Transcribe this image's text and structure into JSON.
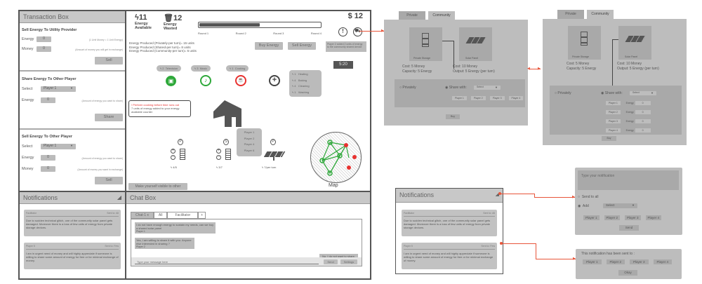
{
  "transaction": {
    "title": "Transaction Box",
    "utility": {
      "title": "Sell Energy To Utility Provider",
      "energy_label": "Energy",
      "energy_value": "0",
      "energy_hint": "(1 Unit Money = 1 Unit Energy)",
      "money_label": "Money",
      "money_value": "0",
      "money_hint": "(Amount of money you will get in exchange)",
      "button": "Sell"
    },
    "share": {
      "title": "Share Energy To Other Player",
      "select_label": "Select",
      "select_value": "Player 1",
      "energy_label": "Energy",
      "energy_value": "0",
      "energy_hint": "(Amount of energy you want to share)",
      "button": "Share"
    },
    "sell_player": {
      "title": "Sell Energy To Other Player",
      "select_label": "Select",
      "select_value": "Player 1",
      "energy_label": "Energy",
      "energy_value": "0",
      "energy_hint": "(Amount of energy you want to share)",
      "money_label": "Money",
      "money_value": "0",
      "money_hint": "(Amount of money you want in exchange)",
      "button": "Sell"
    }
  },
  "game": {
    "energy_available": "11",
    "energy_available_label": "Energy Available",
    "energy_wasted": "12",
    "energy_wasted_label": "Energy Wasted",
    "money": "$ 12",
    "progress": 0.5,
    "rounds": [
      "Round 1",
      "Round 2",
      "Round 3",
      "Round 4"
    ],
    "production": [
      "Energy Produced (Privately-per turn)= 15 units",
      "Energy Produced (Shared-per turn)= 8 units",
      "Energy Produced (Community-per turn)= 6 units"
    ],
    "buy_energy": "Buy Energy",
    "sell_energy": "Sell Energy",
    "tooltip": "Player 2 added 2 units of energy to the community shared device",
    "timer": "5:20",
    "appliances": [
      {
        "cost": "2",
        "name": "Television"
      },
      {
        "cost": "3",
        "name": "Music"
      },
      {
        "cost": "1",
        "name": "Cooking"
      }
    ],
    "add_menu": [
      {
        "cost": "1",
        "name": "Heating"
      },
      {
        "cost": "4",
        "name": "Baking"
      },
      {
        "cost": "4",
        "name": "Cleaning"
      },
      {
        "cost": "1",
        "name": "Washing"
      }
    ],
    "alert_title": "! Perform cooking before time runs out",
    "alert_body": "7 units of energy added to your energy available counter",
    "players_popup": [
      "Player 1",
      "Player 2",
      "Player 4",
      "Player 6"
    ],
    "devices": [
      {
        "badge": "P",
        "value": "4/5"
      },
      {
        "badge": "S",
        "value": "3/7"
      },
      {
        "badge": "P",
        "value": "7/per turn"
      }
    ],
    "map_label": "Map",
    "visible_button": "Make yourself visible to other"
  },
  "notifications": {
    "title": "Notifications",
    "items": [
      {
        "from": "Facilitator",
        "to": "Sent to: All",
        "body": "Due to sudden technical glitch, one of the community solar panel gets damaged. Moreover there is a loss of few units of energy from private storage devices."
      },
      {
        "from": "Player 5",
        "to": "Sent to: Few",
        "body": "I am in urgent need of money and will highly appreciate if someone is willing to share some amount of energy for free or for minimal exchange of money."
      }
    ]
  },
  "chat": {
    "title": "Chat Box",
    "tabs": [
      "Chat-1",
      "All",
      "Facilitator",
      "+"
    ],
    "close": "x",
    "messages": [
      {
        "text": "I do not have enough energy to sustain my needs, can we buy a shared solar panel",
        "author": "Player 1"
      },
      {
        "text": "Yes, I am willing to share it with you. Anyone else interested in sharing ?",
        "author": "Player 2"
      }
    ],
    "reply": "No, I do not want to share.",
    "placeholder": "Type your message here",
    "send": "Send",
    "settings": "Settings"
  },
  "shop": {
    "tabs": [
      "Private",
      "Community"
    ],
    "items": [
      {
        "name": "Private Storage",
        "cost": "Cost: 5 Money",
        "spec": "Capacity: 5 Energy"
      },
      {
        "name": "Solar Panel",
        "cost": "Cost: 10 Money",
        "spec": "Output: 5 Energy (per turn)"
      }
    ],
    "privately": "Privately",
    "share_with": "Share with:",
    "select": "Select",
    "players": [
      "Player 1",
      "Player 2",
      "Player 3",
      "Player 4"
    ],
    "energy_label": "Energy",
    "energy_values": [
      "0",
      "0",
      "0",
      "0"
    ],
    "buy": "Buy"
  },
  "compose": {
    "placeholder": "Type your notification",
    "send_all": "Send to all",
    "add": "Add",
    "select": "Select",
    "players": [
      "Player 1",
      "Player 2",
      "Player 3",
      "Player 4"
    ],
    "send": "Send"
  },
  "sent": {
    "title": "This notification has been sent to :",
    "players": [
      "Player 1",
      "Player 2",
      "Player 3",
      "Player 4"
    ],
    "okay": "Okay"
  },
  "colors": {
    "green": "#2ea83a",
    "red": "#e8312f",
    "arrow": "#e8553a"
  }
}
